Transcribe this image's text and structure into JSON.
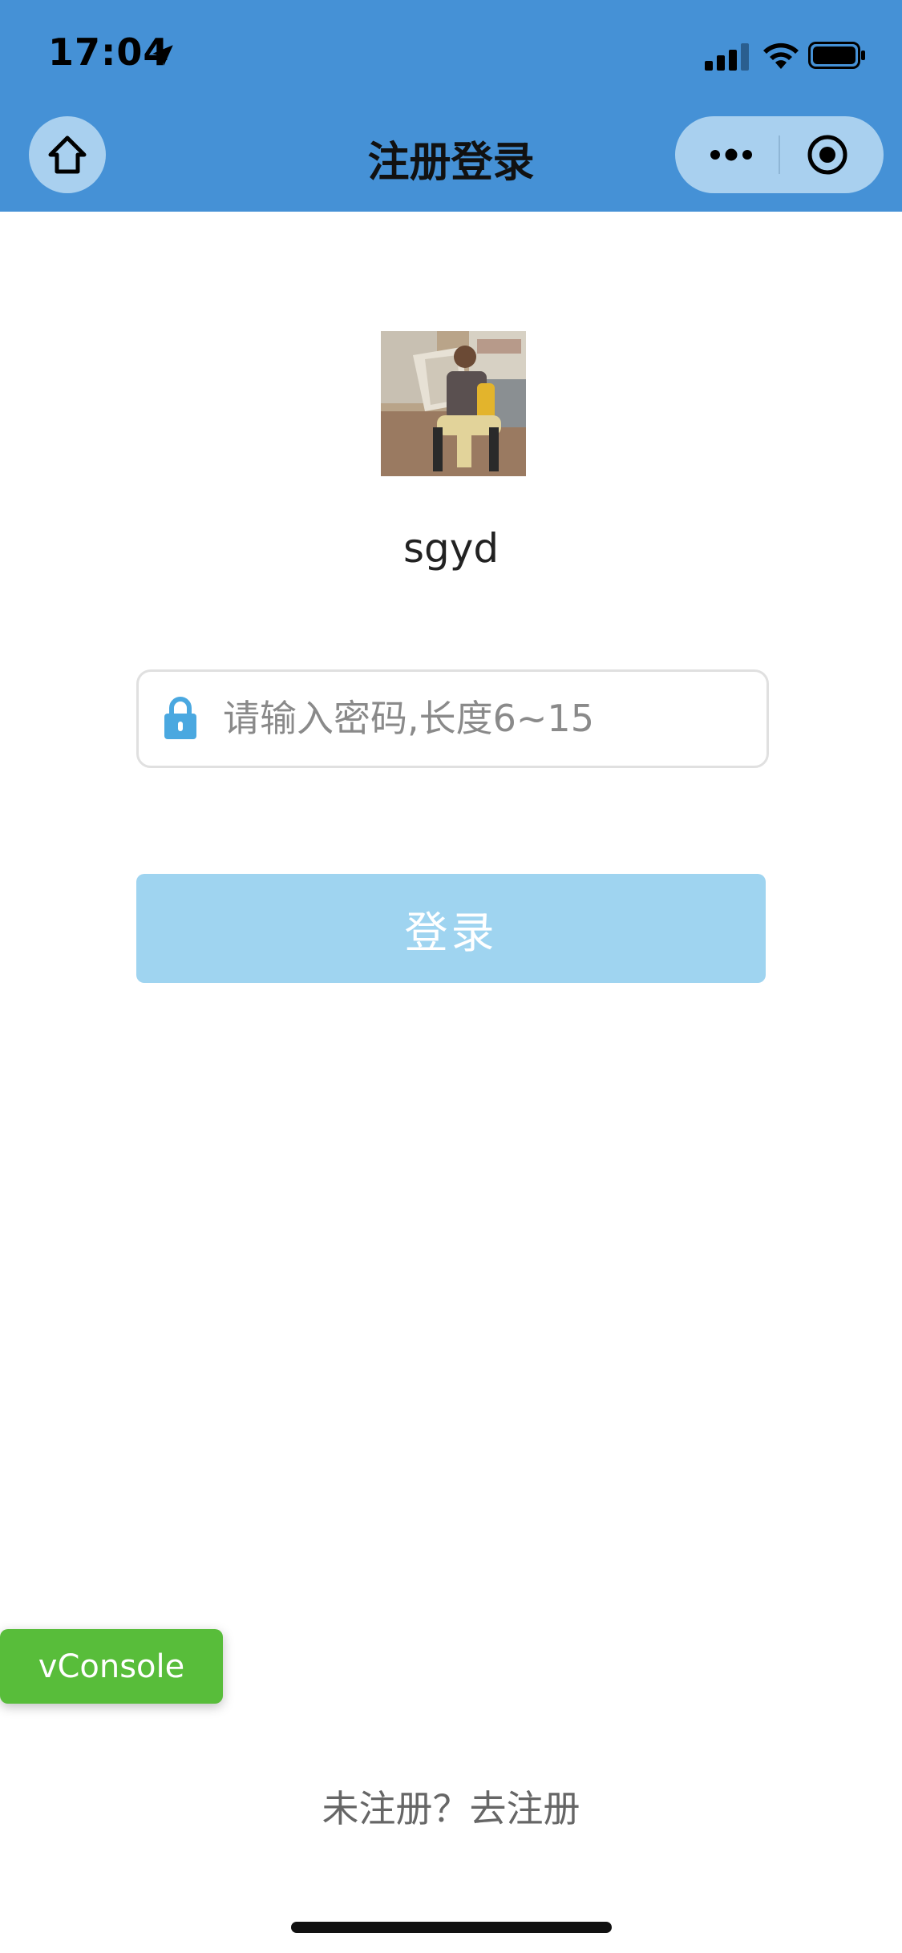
{
  "status_bar": {
    "time": "17:04",
    "icons": [
      "location-arrow-icon",
      "cellular-signal-icon",
      "wifi-icon",
      "battery-icon"
    ]
  },
  "nav": {
    "title": "注册登录",
    "home_icon": "home-icon",
    "more_icon": "more-icon",
    "close_icon": "close-target-icon"
  },
  "profile": {
    "username": "sgyd"
  },
  "password": {
    "placeholder": "请输入密码,长度6~15",
    "value": "",
    "icon": "lock-icon"
  },
  "login_button": {
    "label": "登录"
  },
  "vconsole": {
    "label": "vConsole"
  },
  "footer": {
    "register_text": "未注册？去注册"
  },
  "colors": {
    "header_bg": "#4591d6",
    "capsule_bg": "#a9d0ef",
    "login_bg": "#9fd4f0",
    "lock_color": "#4aa8e0",
    "vconsole_bg": "#58bd3a"
  }
}
